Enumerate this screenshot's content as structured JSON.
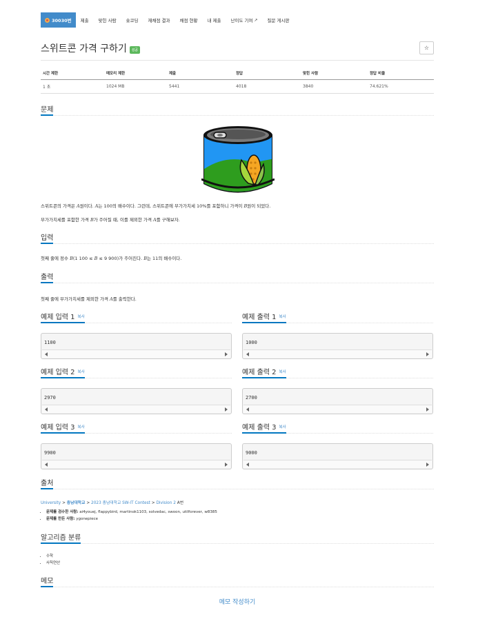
{
  "tabs": [
    {
      "label": "30030번",
      "active": true
    },
    {
      "label": "제출"
    },
    {
      "label": "맞힌 사람"
    },
    {
      "label": "숏코딩"
    },
    {
      "label": "재채점 결과"
    },
    {
      "label": "채점 현황"
    },
    {
      "label": "내 제출"
    },
    {
      "label": "난이도 기여"
    },
    {
      "label": "질문 게시판"
    }
  ],
  "problem": {
    "title": "스위트콘 가격 구하기",
    "badge": "성공",
    "star": "☆"
  },
  "info": {
    "headers": [
      "시간 제한",
      "메모리 제한",
      "제출",
      "정답",
      "맞힌 사람",
      "정답 비율"
    ],
    "values": [
      "1 초",
      "1024 MB",
      "5441",
      "4018",
      "3840",
      "74.621%"
    ]
  },
  "sections": {
    "problem": "문제",
    "input": "입력",
    "output": "출력",
    "source": "출처",
    "algorithm": "알고리즘 분류",
    "memo": "메모"
  },
  "statement": {
    "p1": [
      "스위트콘의 가격은 ",
      "A",
      "원이다. ",
      "A",
      "는 100의 배수이다. 그런데, 스위트콘에 부가가치세 10%를 포함하니 가격이 ",
      "B",
      "원이 되었다."
    ],
    "p2": [
      "부가가치세를 포함한 가격 ",
      "B",
      "가 주어질 때, 이를 제외한 가격 ",
      "A",
      "를 구해보자."
    ]
  },
  "input_desc": [
    "첫째 줄에 정수 ",
    "B",
    "(1 100 ≤ ",
    "B",
    " ≤ 9 900)가 주어진다. ",
    "B",
    "는 11의 배수이다."
  ],
  "output_desc": [
    "첫째 줄에 부가가치세를 제외한 가격 ",
    "A",
    "를 출력한다."
  ],
  "samples": [
    {
      "in_title": "예제 입력 1",
      "out_title": "예제 출력 1",
      "input": "1100",
      "output": "1000"
    },
    {
      "in_title": "예제 입력 2",
      "out_title": "예제 출력 2",
      "input": "2970",
      "output": "2700"
    },
    {
      "in_title": "예제 입력 3",
      "out_title": "예제 출력 3",
      "input": "9900",
      "output": "9000"
    }
  ],
  "copy_label": "복사",
  "source": {
    "parts": [
      "University",
      "충남대학교",
      "2023 충남대학교 SW-IT Contest",
      "Division 2",
      "A번"
    ],
    "sep": ">",
    "checkers_label": "문제를 검수한 사람:",
    "checkers": "ai4youej, flappybird, martinok1103, solvedac, swoon, utilforever, w8385",
    "author_label": "문제를 만든 사람:",
    "author": "ygonepiece"
  },
  "algorithms": [
    "수학",
    "사칙연산"
  ],
  "memo_button": "메모 작성하기",
  "colors": {
    "accent": "#0076c0",
    "tab_active": "#428bca",
    "badge": "#5cb85c"
  }
}
